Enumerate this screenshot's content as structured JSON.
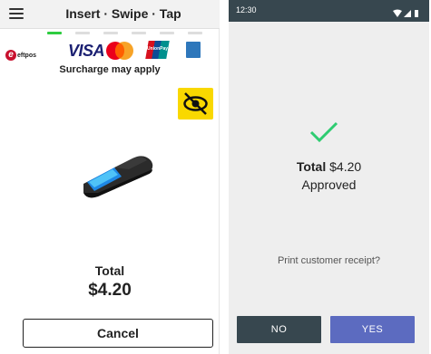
{
  "left_screen": {
    "header": {
      "menu_icon": "hamburger-menu-icon",
      "title": "Insert · Swipe · Tap"
    },
    "step_indicator": {
      "count": 6,
      "active_index": 0,
      "active_color": "#2ecc40",
      "inactive_color": "#dddddd"
    },
    "card_logos": [
      {
        "id": "eftpos",
        "mark": "e",
        "text": "eftpos"
      },
      {
        "id": "visa",
        "text": "VISA"
      },
      {
        "id": "mastercard",
        "text": ""
      },
      {
        "id": "unionpay",
        "text": "UnionPay"
      },
      {
        "id": "amex",
        "text": ""
      }
    ],
    "surcharge_note": "Surcharge may apply",
    "accessibility_icon": "eye-slash-icon",
    "terminal_image": "payment-terminal-icon",
    "total_label": "Total",
    "total_amount": "$4.20",
    "cancel_label": "Cancel"
  },
  "right_screen": {
    "status_bar": {
      "time": "12:30",
      "icons": [
        "wifi-icon",
        "signal-icon",
        "battery-icon"
      ],
      "background": "#37474f"
    },
    "success_icon": "checkmark-icon",
    "success_color": "#2ecc71",
    "total_label": "Total",
    "total_amount": "$4.20",
    "status_text": "Approved",
    "print_prompt": "Print customer receipt?",
    "no_label": "NO",
    "yes_label": "YES",
    "no_color": "#37474f",
    "yes_color": "#5c6bc0"
  }
}
